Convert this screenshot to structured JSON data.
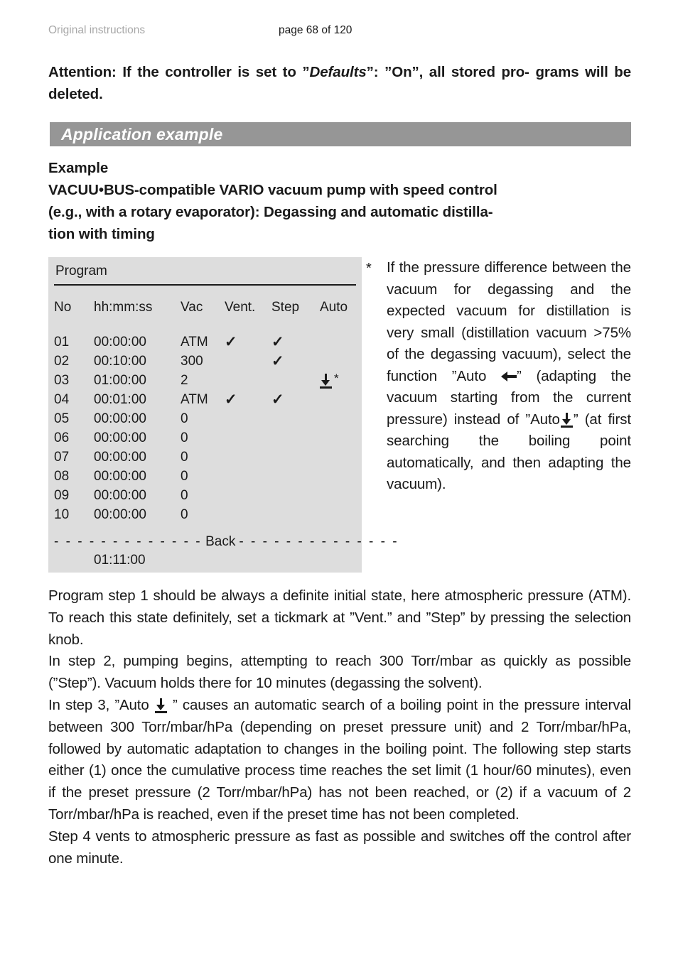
{
  "header": {
    "left": "Original instructions",
    "center": "page 68 of 120"
  },
  "attention": {
    "line1_a": "Attention: If the controller is set to ”",
    "line1_em": "Defaults",
    "line1_b": "”: ”On”, all stored pro-",
    "line2": "grams will be deleted."
  },
  "banner": {
    "label": "Application example"
  },
  "example": {
    "heading": "Example",
    "line1": "VACUU•BUS-compatible VARIO vacuum pump with speed control",
    "line2": "(e.g., with a rotary evaporator): Degassing and automatic distilla-",
    "line3": "tion with timing"
  },
  "panel": {
    "title": "Program",
    "columns": {
      "no": "No",
      "time": "hh:mm:ss",
      "vac": "Vac",
      "vent": "Vent.",
      "step": "Step",
      "auto": "Auto"
    },
    "tick_glyph": "✓",
    "star_glyph": "*",
    "rows": [
      {
        "no": "01",
        "time": "00:00:00",
        "vac": "ATM",
        "vent": "✓",
        "step": "✓",
        "auto": ""
      },
      {
        "no": "02",
        "time": "00:10:00",
        "vac": "300",
        "vent": "",
        "step": "✓",
        "auto": ""
      },
      {
        "no": "03",
        "time": "01:00:00",
        "vac": "2",
        "vent": "",
        "step": "",
        "auto": "auto-down-arrow-icon*"
      },
      {
        "no": "04",
        "time": "00:01:00",
        "vac": "ATM",
        "vent": "✓",
        "step": "✓",
        "auto": ""
      },
      {
        "no": "05",
        "time": "00:00:00",
        "vac": "0",
        "vent": "",
        "step": "",
        "auto": ""
      },
      {
        "no": "06",
        "time": "00:00:00",
        "vac": "0",
        "vent": "",
        "step": "",
        "auto": ""
      },
      {
        "no": "07",
        "time": "00:00:00",
        "vac": "0",
        "vent": "",
        "step": "",
        "auto": ""
      },
      {
        "no": "08",
        "time": "00:00:00",
        "vac": "0",
        "vent": "",
        "step": "",
        "auto": ""
      },
      {
        "no": "09",
        "time": "00:00:00",
        "vac": "0",
        "vent": "",
        "step": "",
        "auto": ""
      },
      {
        "no": "10",
        "time": "00:00:00",
        "vac": "0",
        "vent": "",
        "step": "",
        "auto": ""
      }
    ],
    "back_label": "Back",
    "dashes_left": "- - - - - - - - - - - - -",
    "dashes_right": "- - - - - - - - - - - - - -",
    "total_time": "01:11:00"
  },
  "footnote": {
    "marker": "*",
    "text_a": "If the pressure difference between the vacuum for degassing and the expected vacuum for distillation is very small (distillation vacuum >75% of the degassing vacuum), select the function ”Auto ",
    "text_b": "” (adapting the vacuum starting from the current pressure) instead of ”Auto",
    "text_c": "” (at first searching the boiling point automatically, and then adapting the vacuum).",
    "icon_adapt": "arrow-left-bar-icon",
    "icon_auto_down": "arrow-down-bar-icon"
  },
  "body": {
    "p1": "Program step 1 should be always a definite initial state, here atmospheric pressure (ATM). To reach this state definitely, set a tickmark at ”Vent.” and ”Step” by pressing the selection knob.",
    "p2": "In step 2, pumping begins, attempting to reach 300 Torr/mbar as quickly as possible (”Step”). Vacuum holds there for 10 minutes (degassing the solvent).",
    "p3_a": "In step 3, ”Auto ",
    "p3_b": " ” causes an automatic search of a boiling point in the pressure interval between 300 Torr/mbar/hPa (depending on preset pressure unit) and 2 Torr/mbar/hPa, followed by automatic adaptation to changes in the boiling point. The following step starts either (1) once the cumulative process time reaches the set limit (1 hour/60 minutes), even if the preset pressure (2 Torr/mbar/hPa) has not been reached, or (2) if a vacuum of 2 Torr/mbar/hPa is reached, even if the preset time has not been completed.",
    "p4": "Step 4 vents to atmospheric pressure as fast as possible and switches off the control after one minute."
  },
  "colors": {
    "banner_gray": "#969696",
    "panel_gray": "#dddddd",
    "header_gray": "#a8a8a8",
    "text": "#1a1a1a"
  }
}
